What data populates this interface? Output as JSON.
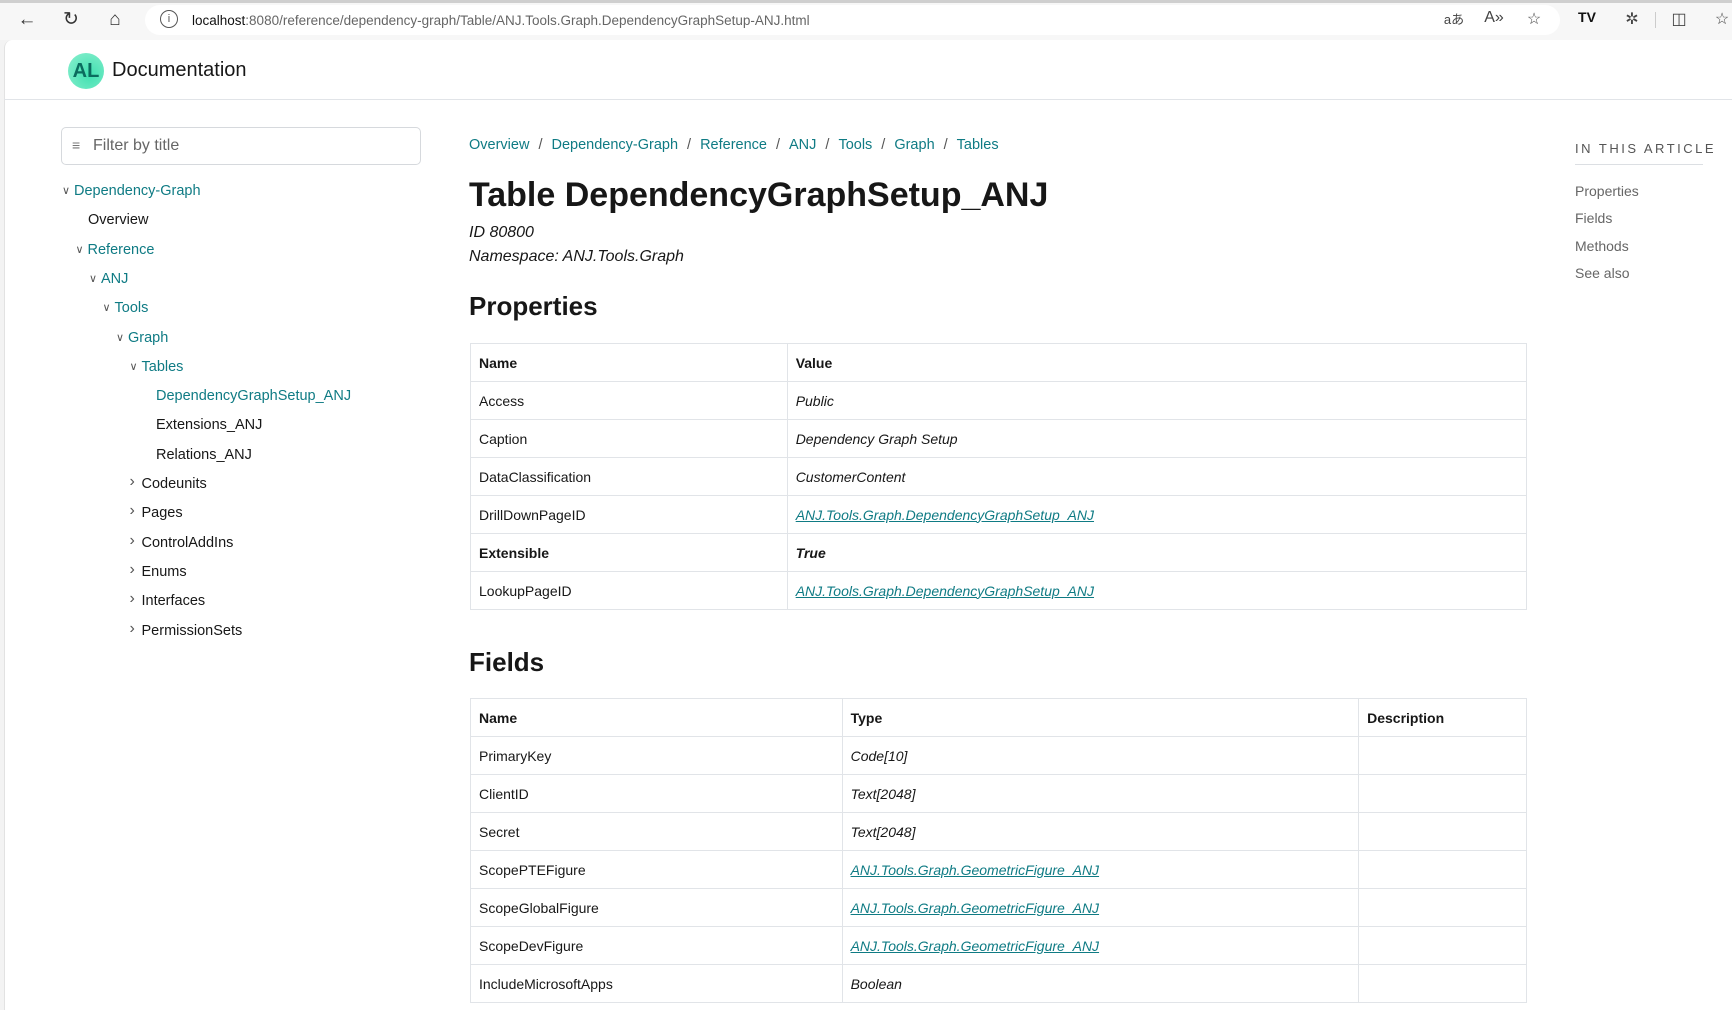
{
  "browser": {
    "url_host": "localhost",
    "url_path": ":8080/reference/dependency-graph/Table/ANJ.Tools.Graph.DependencyGraphSetup-ANJ.html",
    "profile_badge": "TV"
  },
  "header": {
    "logo_text": "AL",
    "title": "Documentation"
  },
  "sidebar": {
    "filter_placeholder": "Filter by title",
    "items": [
      {
        "label": "Dependency-Graph",
        "expanded": true
      },
      {
        "label": "Overview"
      },
      {
        "label": "Reference",
        "expanded": true
      },
      {
        "label": "ANJ",
        "expanded": true
      },
      {
        "label": "Tools",
        "expanded": true
      },
      {
        "label": "Graph",
        "expanded": true
      },
      {
        "label": "Tables",
        "expanded": true
      },
      {
        "label": "DependencyGraphSetup_ANJ",
        "active": true
      },
      {
        "label": "Extensions_ANJ"
      },
      {
        "label": "Relations_ANJ"
      },
      {
        "label": "Codeunits",
        "expanded": false
      },
      {
        "label": "Pages",
        "expanded": false
      },
      {
        "label": "ControlAddIns",
        "expanded": false
      },
      {
        "label": "Enums",
        "expanded": false
      },
      {
        "label": "Interfaces",
        "expanded": false
      },
      {
        "label": "PermissionSets",
        "expanded": false
      }
    ]
  },
  "breadcrumb": [
    "Overview",
    "Dependency-Graph",
    "Reference",
    "ANJ",
    "Tools",
    "Graph",
    "Tables"
  ],
  "main": {
    "title": "Table DependencyGraphSetup_ANJ",
    "id": "ID 80800",
    "namespace": "Namespace: ANJ.Tools.Graph",
    "properties": {
      "heading": "Properties",
      "columns": [
        "Name",
        "Value"
      ],
      "rows": [
        [
          "Access",
          "Public"
        ],
        [
          "Caption",
          "Dependency Graph Setup"
        ],
        [
          "DataClassification",
          "CustomerContent"
        ],
        [
          "DrillDownPageID",
          "ANJ.Tools.Graph.DependencyGraphSetup_ANJ"
        ],
        [
          "Extensible",
          "True"
        ],
        [
          "LookupPageID",
          "ANJ.Tools.Graph.DependencyGraphSetup_ANJ"
        ]
      ]
    },
    "fields": {
      "heading": "Fields",
      "columns": [
        "Name",
        "Type",
        "Description"
      ],
      "rows": [
        [
          "PrimaryKey",
          "Code[10]",
          ""
        ],
        [
          "ClientID",
          "Text[2048]",
          ""
        ],
        [
          "Secret",
          "Text[2048]",
          ""
        ],
        [
          "ScopePTEFigure",
          "ANJ.Tools.Graph.GeometricFigure_ANJ",
          ""
        ],
        [
          "ScopeGlobalFigure",
          "ANJ.Tools.Graph.GeometricFigure_ANJ",
          ""
        ],
        [
          "ScopeDevFigure",
          "ANJ.Tools.Graph.GeometricFigure_ANJ",
          ""
        ],
        [
          "IncludeMicrosoftApps",
          "Boolean",
          ""
        ]
      ]
    }
  },
  "toc": {
    "title": "IN THIS ARTICLE",
    "items": [
      "Properties",
      "Fields",
      "Methods",
      "See also"
    ]
  },
  "colors": {
    "accent": "#0f7b84",
    "text": "#171717",
    "border": "#e1e4e8"
  }
}
